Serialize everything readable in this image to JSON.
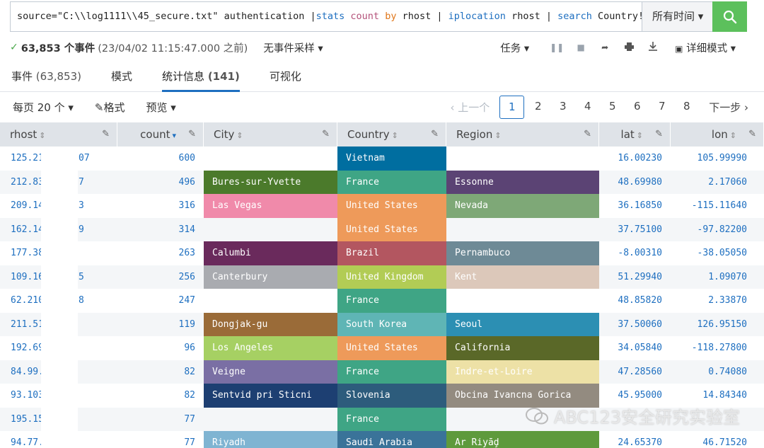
{
  "search": {
    "q_source": "source=\"C:\\\\log1111\\\\45_secure.txt\" authentication |",
    "q_stats": "stats",
    "q_count": "count",
    "q_by": "by",
    "q_rhost1": "rhost |",
    "q_iplocation": "iplocation",
    "q_rhost2": "rhost |",
    "q_search": "search",
    "q_filter": "Country!=\"China\"",
    "time_range": "所有时间 ▾",
    "button_icon": "search-icon"
  },
  "status": {
    "events": "63,853 个事件",
    "timestamp": "(23/04/02 11:15:47.000 之前)",
    "sampling": "无事件采样 ▾",
    "job": "任务 ▾",
    "mode": "详细模式 ▾"
  },
  "tabs": [
    {
      "label": "事件",
      "count": "(63,853)"
    },
    {
      "label": "模式",
      "count": ""
    },
    {
      "label": "统计信息",
      "count": "(141)"
    },
    {
      "label": "可视化",
      "count": ""
    }
  ],
  "pagination": {
    "per_page": "每页 20 个 ▾",
    "format": "格式",
    "preview": "预览 ▾",
    "prev": "‹ 上一个",
    "pages": [
      "1",
      "2",
      "3",
      "4",
      "5",
      "6",
      "7",
      "8"
    ],
    "current_page": "1",
    "next": "下一步 ›"
  },
  "table": {
    "headers": [
      "rhost",
      "count",
      "City",
      "Country",
      "Region",
      "lat",
      "lon"
    ],
    "rows": [
      {
        "rhost": "125.21",
        "rhost_tail": "07",
        "count": "600",
        "city": "",
        "country": "Vietnam",
        "region": "",
        "lat": "16.00230",
        "lon": "105.99990",
        "city_color": "",
        "country_color": "#006ea0",
        "region_color": ""
      },
      {
        "rhost": "212.83",
        "rhost_tail": "7",
        "count": "496",
        "city": "Bures-sur-Yvette",
        "country": "France",
        "region": "Essonne",
        "lat": "48.69980",
        "lon": "2.17060",
        "city_color": "#4b7a2b",
        "country_color": "#3fa585",
        "region_color": "#5b4374"
      },
      {
        "rhost": "209.14",
        "rhost_tail": "3",
        "count": "316",
        "city": "Las Vegas",
        "country": "United States",
        "region": "Nevada",
        "lat": "36.16850",
        "lon": "-115.11640",
        "city_color": "#f08aaa",
        "country_color": "#ee9a5a",
        "region_color": "#7ea877"
      },
      {
        "rhost": "162.14",
        "rhost_tail": "9",
        "count": "314",
        "city": "",
        "country": "United States",
        "region": "",
        "lat": "37.75100",
        "lon": "-97.82200",
        "city_color": "",
        "country_color": "#ee9a5a",
        "region_color": ""
      },
      {
        "rhost": "177.38",
        "rhost_tail": "",
        "count": "263",
        "city": "Calumbi",
        "country": "Brazil",
        "region": "Pernambuco",
        "lat": "-8.00310",
        "lon": "-38.05050",
        "city_color": "#6a2a5c",
        "country_color": "#b35660",
        "region_color": "#6e8a96"
      },
      {
        "rhost": "109.16",
        "rhost_tail": "5",
        "count": "256",
        "city": "Canterbury",
        "country": "United Kingdom",
        "region": "Kent",
        "lat": "51.29940",
        "lon": "1.09070",
        "city_color": "#a9abb0",
        "country_color": "#b2cc55",
        "region_color": "#dcc8ba"
      },
      {
        "rhost": "62.210",
        "rhost_tail": "8",
        "count": "247",
        "city": "",
        "country": "France",
        "region": "",
        "lat": "48.85820",
        "lon": "2.33870",
        "city_color": "",
        "country_color": "#3fa585",
        "region_color": ""
      },
      {
        "rhost": "211.51",
        "rhost_tail": "",
        "count": "119",
        "city": "Dongjak-gu",
        "country": "South Korea",
        "region": "Seoul",
        "lat": "37.50060",
        "lon": "126.95150",
        "city_color": "#9a6b38",
        "country_color": "#5fb5b5",
        "region_color": "#2c8fb3"
      },
      {
        "rhost": "192.69",
        "rhost_tail": "",
        "count": "96",
        "city": "Los Angeles",
        "country": "United States",
        "region": "California",
        "lat": "34.05840",
        "lon": "-118.27800",
        "city_color": "#a6d063",
        "country_color": "#ee9a5a",
        "region_color": "#5a6828"
      },
      {
        "rhost": "84.99.",
        "rhost_tail": "",
        "count": "82",
        "city": "Veigne",
        "country": "France",
        "region": "Indre-et-Loire",
        "lat": "47.28560",
        "lon": "0.74080",
        "city_color": "#7a6fa4",
        "country_color": "#3fa585",
        "region_color": "#ede1a6"
      },
      {
        "rhost": "93.103",
        "rhost_tail": "",
        "count": "82",
        "city": "Sentvid pri Sticni",
        "country": "Slovenia",
        "region": "Obcina Ivancna Gorica",
        "lat": "45.95000",
        "lon": "14.84340",
        "city_color": "#1d3f72",
        "country_color": "#2d5c7c",
        "region_color": "#938b80"
      },
      {
        "rhost": "195.15",
        "rhost_tail": "",
        "count": "77",
        "city": "",
        "country": "France",
        "region": "",
        "lat": "",
        "lon": "",
        "city_color": "",
        "country_color": "#3fa585",
        "region_color": ""
      },
      {
        "rhost": "94.77.",
        "rhost_tail": "",
        "count": "77",
        "city": "Riyadh",
        "country": "Saudi Arabia",
        "region": "Ar Riyāḑ",
        "lat": "24.65370",
        "lon": "46.71520",
        "city_color": "#7fb4d2",
        "country_color": "#3a7399",
        "region_color": "#5e9a3c"
      }
    ]
  },
  "watermark": {
    "text": "ABC123安全研究实验室"
  },
  "colors": {
    "accent": "#1e6fc0",
    "search_button": "#5cc05c",
    "header_bg": "#dfe3e8"
  }
}
